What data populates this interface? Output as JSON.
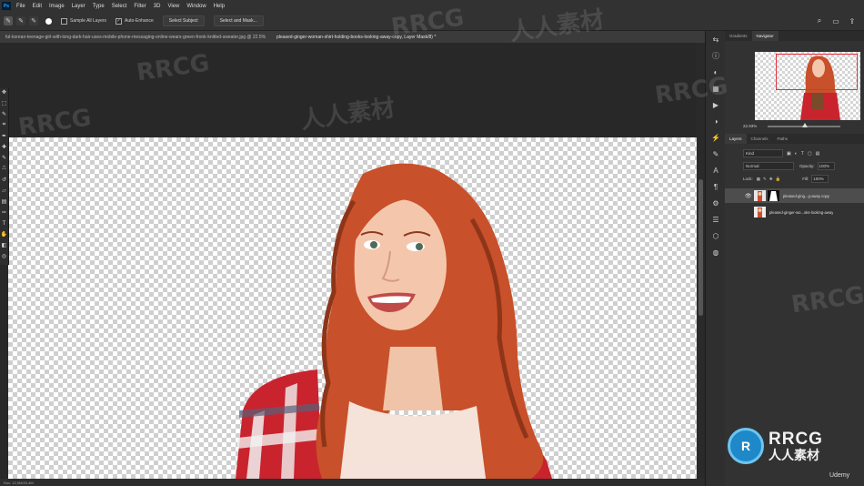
{
  "app": {
    "logo_text": "Ps"
  },
  "menubar": {
    "items": [
      "File",
      "Edit",
      "Image",
      "Layer",
      "Type",
      "Select",
      "Filter",
      "3D",
      "View",
      "Window",
      "Help"
    ]
  },
  "options_bar": {
    "sample_all_layers": "Sample All Layers",
    "auto_enhance": "Auto-Enhance",
    "select_subject": "Select Subject",
    "select_and_mask": "Select and Mask..."
  },
  "tabs": [
    {
      "label": "ful-korean-teenage-girl-with-long-dark-hair-uses-mobile-phone-messaging-online-wears-green-fronk-knitted-sweater.jpg @ 22.5%",
      "active": false
    },
    {
      "label": "pleased-ginger-woman-shirt-holding-books-looking-away-copy, Layer Mask/8) *",
      "active": true
    }
  ],
  "panels": {
    "top_tabs": [
      "Gradients",
      "Navigator"
    ],
    "navigator_zoom": "22.93%",
    "layer_tabs": [
      "Layers",
      "Channels",
      "Paths"
    ],
    "filter_kind": "Kind",
    "blend_mode": "Normal",
    "opacity_label": "Opacity:",
    "opacity_value": "100%",
    "lock_label": "Lock:",
    "fill_label": "Fill:",
    "fill_value": "100%",
    "layers": [
      {
        "name": "pleased-ging...g-away copy",
        "selected": true
      },
      {
        "name": "pleased-ginger-wo...oks-looking-away",
        "selected": false
      }
    ]
  },
  "status": {
    "text": "Doc: 12,0M/20,4M"
  },
  "watermark": {
    "brand": "RRCG",
    "chinese": "人人素材",
    "provider": "Udemy"
  }
}
